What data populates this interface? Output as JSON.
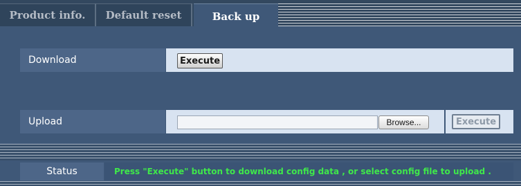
{
  "tabs": [
    {
      "label": "Product info.",
      "active": false
    },
    {
      "label": "Default reset",
      "active": false
    },
    {
      "label": "Back up",
      "active": true
    }
  ],
  "download": {
    "label": "Download",
    "execute_label": "Execute"
  },
  "upload": {
    "label": "Upload",
    "file_value": "",
    "browse_label": "Browse...",
    "execute_label": "Execute",
    "execute_enabled": false
  },
  "status": {
    "label": "Status",
    "message": "Press \"Execute\" button to download config data , or select config file to upload ."
  },
  "colors": {
    "background": "#3f5878",
    "status_text": "#3fe84a"
  }
}
